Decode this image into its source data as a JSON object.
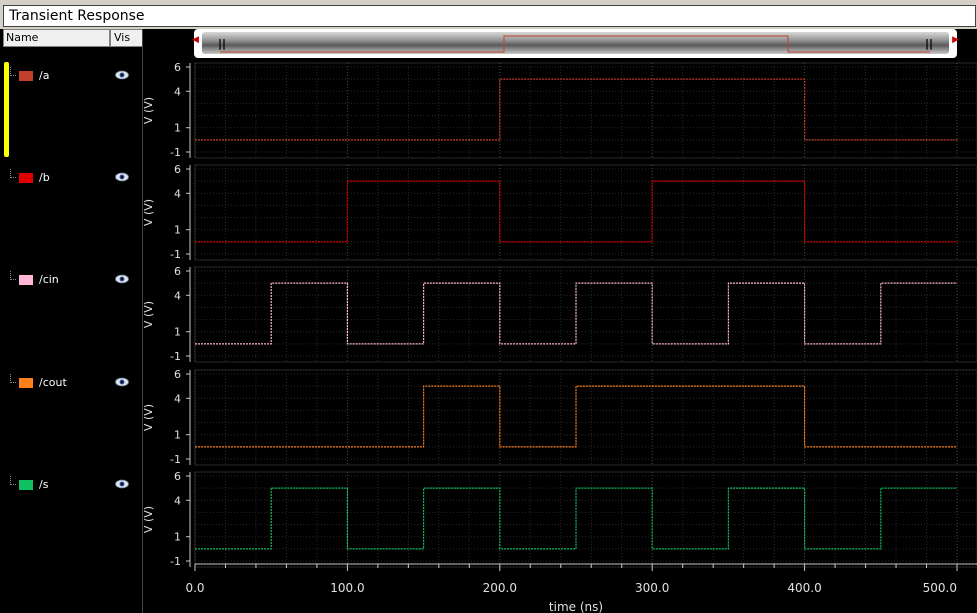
{
  "window": {
    "title": "Transient Response"
  },
  "panel": {
    "name_header": "Name",
    "vis_header": "Vis",
    "signals": [
      {
        "label": "/a",
        "color": "#c0402a"
      },
      {
        "label": "/b",
        "color": "#e00000"
      },
      {
        "label": "/cin",
        "color": "#ffb6d9"
      },
      {
        "label": "/cout",
        "color": "#ff7f1a"
      },
      {
        "label": "/s",
        "color": "#10c060"
      }
    ]
  },
  "chart_data": {
    "type": "line",
    "xlabel": "time (ns)",
    "xlim": [
      0,
      500
    ],
    "x_ticks": [
      "0.0",
      "100.0",
      "200.0",
      "300.0",
      "400.0",
      "500.0"
    ],
    "ylabel": "V (V)",
    "ylim": [
      -1,
      6
    ],
    "y_ticks": [
      "6",
      "4",
      "1",
      "-1"
    ],
    "grid": true,
    "series": [
      {
        "name": "/a",
        "color": "#c0402a",
        "low": 0,
        "high": 5,
        "transitions": [
          [
            0,
            0
          ],
          [
            200,
            5
          ],
          [
            400,
            0
          ]
        ]
      },
      {
        "name": "/b",
        "color": "#e00000",
        "low": 0,
        "high": 5,
        "transitions": [
          [
            0,
            0
          ],
          [
            100,
            5
          ],
          [
            200,
            0
          ],
          [
            300,
            5
          ],
          [
            400,
            0
          ]
        ]
      },
      {
        "name": "/cin",
        "color": "#ffb6d9",
        "low": 0,
        "high": 5,
        "transitions": [
          [
            0,
            0
          ],
          [
            50,
            5
          ],
          [
            100,
            0
          ],
          [
            150,
            5
          ],
          [
            200,
            0
          ],
          [
            250,
            5
          ],
          [
            300,
            0
          ],
          [
            350,
            5
          ],
          [
            400,
            0
          ],
          [
            450,
            5
          ]
        ]
      },
      {
        "name": "/cout",
        "color": "#ff7f1a",
        "low": 0,
        "high": 5,
        "transitions": [
          [
            0,
            0
          ],
          [
            150,
            5
          ],
          [
            200,
            0
          ],
          [
            250,
            5
          ],
          [
            400,
            0
          ]
        ]
      },
      {
        "name": "/s",
        "color": "#10c060",
        "low": 0,
        "high": 5,
        "transitions": [
          [
            0,
            0
          ],
          [
            50,
            5
          ],
          [
            100,
            0
          ],
          [
            150,
            5
          ],
          [
            200,
            0
          ],
          [
            250,
            5
          ],
          [
            300,
            0
          ],
          [
            350,
            5
          ],
          [
            400,
            0
          ],
          [
            450,
            5
          ]
        ]
      }
    ],
    "overview": {
      "series": "/a",
      "color": "#c0402a",
      "transitions": [
        [
          0,
          0
        ],
        [
          200,
          5
        ],
        [
          400,
          0
        ]
      ]
    }
  }
}
